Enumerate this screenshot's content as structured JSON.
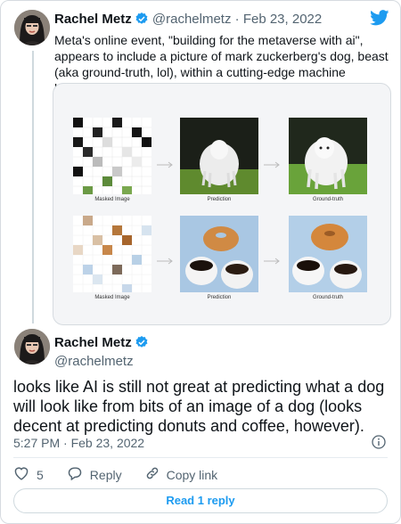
{
  "colors": {
    "accent": "#1d9bf0",
    "muted": "#536471",
    "border": "#cfd9de"
  },
  "icons": [
    "verified-badge-icon",
    "twitter-bird-icon",
    "info-icon",
    "heart-icon",
    "reply-icon",
    "link-icon"
  ],
  "quoted": {
    "name": "Rachel Metz",
    "handle": "@rachelmetz",
    "separator": "·",
    "date": "Feb 23, 2022",
    "text": "Meta's online event, \"building for the metaverse with ai\", appears to include a picture of mark zuckerberg's dog, beast (aka ground-truth, lol), within a cutting-edge machine learning example.",
    "media": {
      "captions": {
        "masked": "Masked Image",
        "prediction": "Prediction",
        "ground_truth": "Ground-truth"
      }
    }
  },
  "tweet": {
    "name": "Rachel Metz",
    "handle": "@rachelmetz",
    "text": "looks like AI is still not great at predicting what a dog will look like from bits of an image of a dog (looks decent at predicting donuts and coffee, however).",
    "time": "5:27 PM · Feb 23, 2022",
    "likes": "5",
    "reply_label": "Reply",
    "copy_label": "Copy link",
    "read_replies": "Read 1 reply"
  }
}
